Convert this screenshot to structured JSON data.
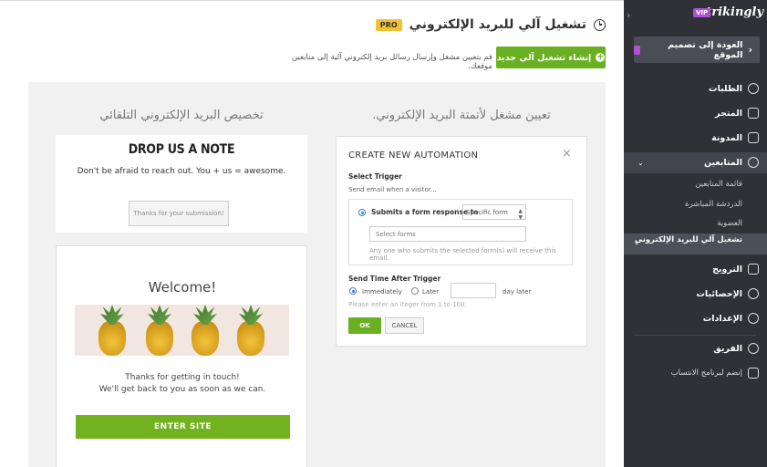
{
  "header": {
    "title": "تشغيل آلي للبريد الإلكتروني",
    "badge": "PRO"
  },
  "toolbar": {
    "create_label": "إنشاء تشغيل آلي جديد",
    "description": "قم بتعيين مشغل وإرسال رسائل بريد إلكتروني آلية إلى متابعين موقعك."
  },
  "columns": {
    "left_title": "تخصيص البريد الإلكتروني التلقائي",
    "right_title": "تعيين مشغل لأتمتة البريد الإلكتروني."
  },
  "note_card": {
    "heading": "DROP US A NOTE",
    "subtext": "Don't be afraid to reach out. You + us = awesome.",
    "button": "Thanks for your submission!"
  },
  "email_preview": {
    "welcome": "Welcome!",
    "line1": "Thanks for getting in touch!",
    "line2": "We'll get back to you as soon as we can.",
    "button": "ENTER SITE"
  },
  "modal": {
    "title": "CREATE NEW AUTOMATION",
    "close": "×",
    "select_trigger": "Select Trigger",
    "send_when": "Send email when a visitor...",
    "option_label": "Submits a form response to",
    "select_value": "Specific form",
    "forms_placeholder": "Select forms",
    "any_text": "Any one who submits the selected form(s) will receive this email.",
    "send_time_label": "Send Time After Trigger",
    "immediately": "Immediately",
    "later": "Later",
    "day_later": "day later",
    "hint": "Please enter an iteger  from 1 to 100.",
    "ok": "OK",
    "cancel": "CANCEL"
  },
  "sidebar": {
    "logo": "strikingly",
    "vip": "VIP",
    "back": "العودة إلى تصميم الموقع",
    "items": {
      "orders": "الطلبات",
      "store": "المتجر",
      "blog": "المدونة",
      "followers": "المتابعين",
      "follower_list": "قائمة المتابعين",
      "live_chat": "الدردشة المباشرة",
      "membership": "العضوية",
      "email_automation": "تشغيل آلي للبريد الإلكتروني",
      "promotion": "الترويج",
      "analytics": "الإحصائيات",
      "settings": "الإعدادات",
      "team": "الفريق",
      "affiliate": "إنضم لبرنامج الانتساب"
    }
  },
  "colors": {
    "accent": "#6ab023",
    "sidebar_bg": "#2f3136",
    "pro_badge": "#f3c233",
    "vip": "#b14fd6"
  }
}
